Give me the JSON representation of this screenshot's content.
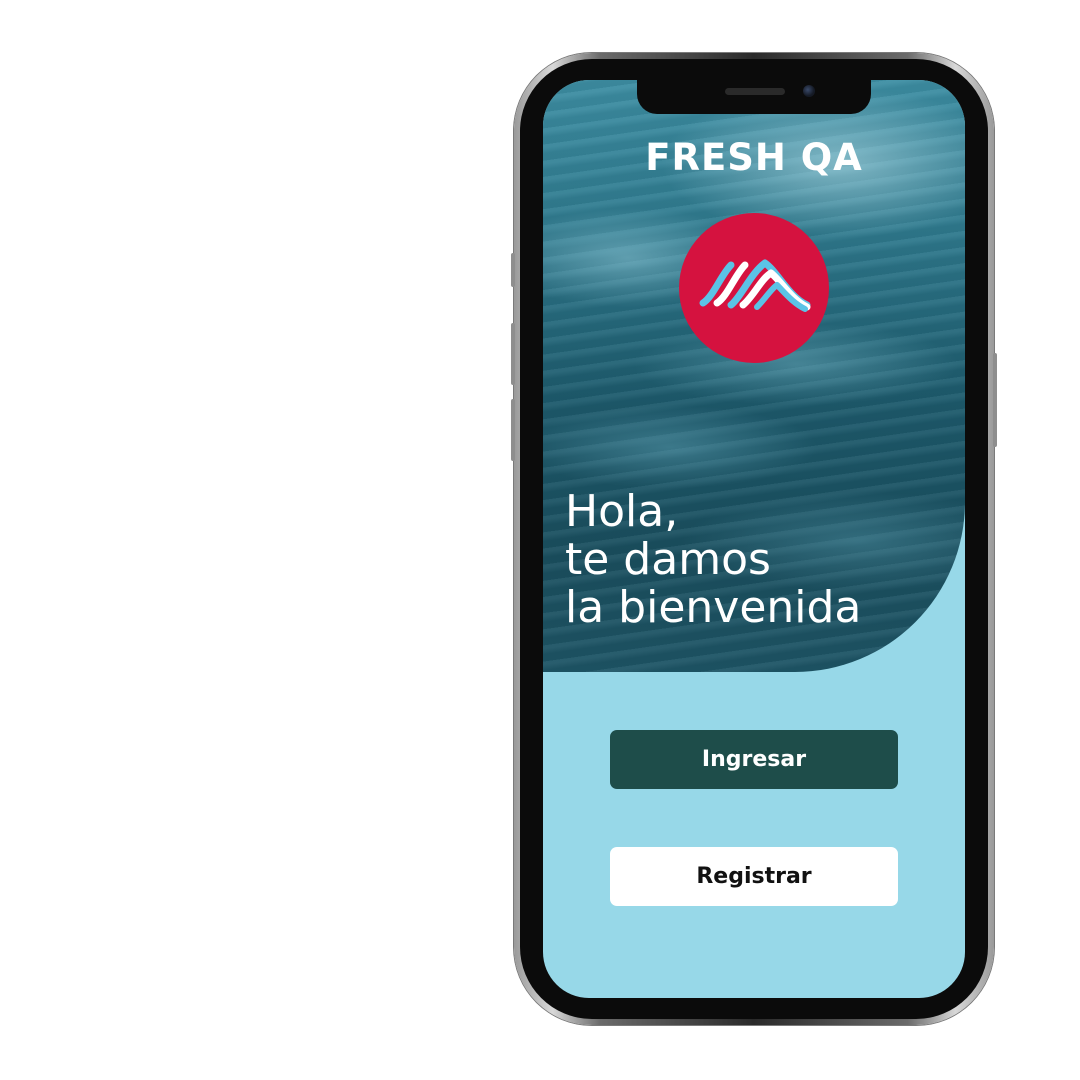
{
  "app": {
    "title": "FRESH QA",
    "logo_name": "fresh-qa-logo",
    "brand_color": "#d5123f"
  },
  "welcome": {
    "line1": "Hola,",
    "line2": "te damos",
    "line3": "la bienvenida"
  },
  "actions": {
    "login_label": "Ingresar",
    "register_label": "Registrar"
  },
  "colors": {
    "screen_background": "#97d8e8",
    "primary_button": "#1e4d4a",
    "secondary_button": "#ffffff",
    "logo_waves": [
      "#5bc3e6",
      "#ffffff"
    ]
  }
}
